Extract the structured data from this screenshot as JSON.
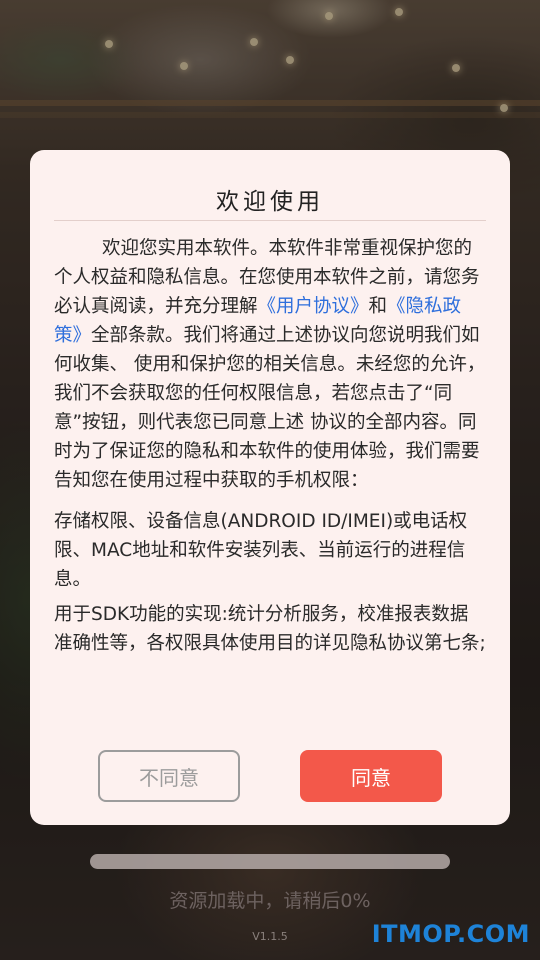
{
  "dialog": {
    "title": "欢迎使用",
    "p1_a": "欢迎您实用本软件。本软件非常重视保护您的个人权益和隐私信息。在您使用本软件之前，请您务必认真阅读，并充分理解",
    "link_user_agreement": "《用户协议》",
    "p1_and": "和",
    "link_privacy_policy": "《隐私政策》",
    "p1_b": "全部条款。我们将通过上述协议向您说明我们如何收集、 使用和保护您的相关信息。未经您的允许，我们不会获取您的任何权限信息，若您点击了“同意”按钮，则代表您已同意上述 协议的全部内容。同时为了保证您的隐私和本软件的使用体验，我们需要告知您在使用过程中获取的手机权限：",
    "p2": "存储权限、设备信息(ANDROID ID/IMEI)或电话权限、MAC地址和软件安装列表、当前运行的进程信息。",
    "p3": "用于SDK功能的实现:统计分析服务，校准报表数据准确性等，各权限具体使用目的详见隐私协议第七条;",
    "disagree_label": "不同意",
    "agree_label": "同意"
  },
  "loading": {
    "text": "资源加载中，请稍后0%",
    "progress": 0
  },
  "version": "V1.1.5",
  "watermark": "ITMOP.COM",
  "colors": {
    "accent": "#f3584a",
    "link": "#2f6fdc",
    "dialog_bg": "#fdf1ef"
  }
}
